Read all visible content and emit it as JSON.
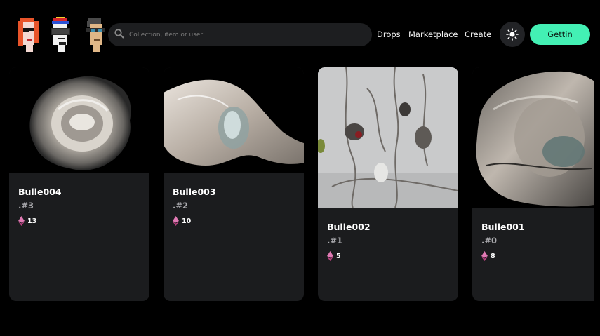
{
  "header": {
    "avatars": [
      {
        "icon": "punk-avatar-red-hair-icon"
      },
      {
        "icon": "punk-avatar-vr-goggles-icon"
      },
      {
        "icon": "punk-avatar-glasses-icon"
      }
    ],
    "search": {
      "placeholder": "Collection, item or user",
      "value": ""
    },
    "nav": {
      "drops": "Drops",
      "marketplace": "Marketplace",
      "create": "Create"
    },
    "theme_toggle_icon": "sun-icon",
    "cta_label": "Gettin"
  },
  "colors": {
    "accent": "#43f0b4",
    "card_bg": "#1b1c1e",
    "eth": "#d35e9e"
  },
  "cards": [
    {
      "name": "Bulle004",
      "edition": ".#3",
      "price": "13"
    },
    {
      "name": "Bulle003",
      "edition": ".#2",
      "price": "10"
    },
    {
      "name": "Bulle002",
      "edition": ".#1",
      "price": "5"
    },
    {
      "name": "Bulle001",
      "edition": ".#0",
      "price": "8"
    }
  ]
}
